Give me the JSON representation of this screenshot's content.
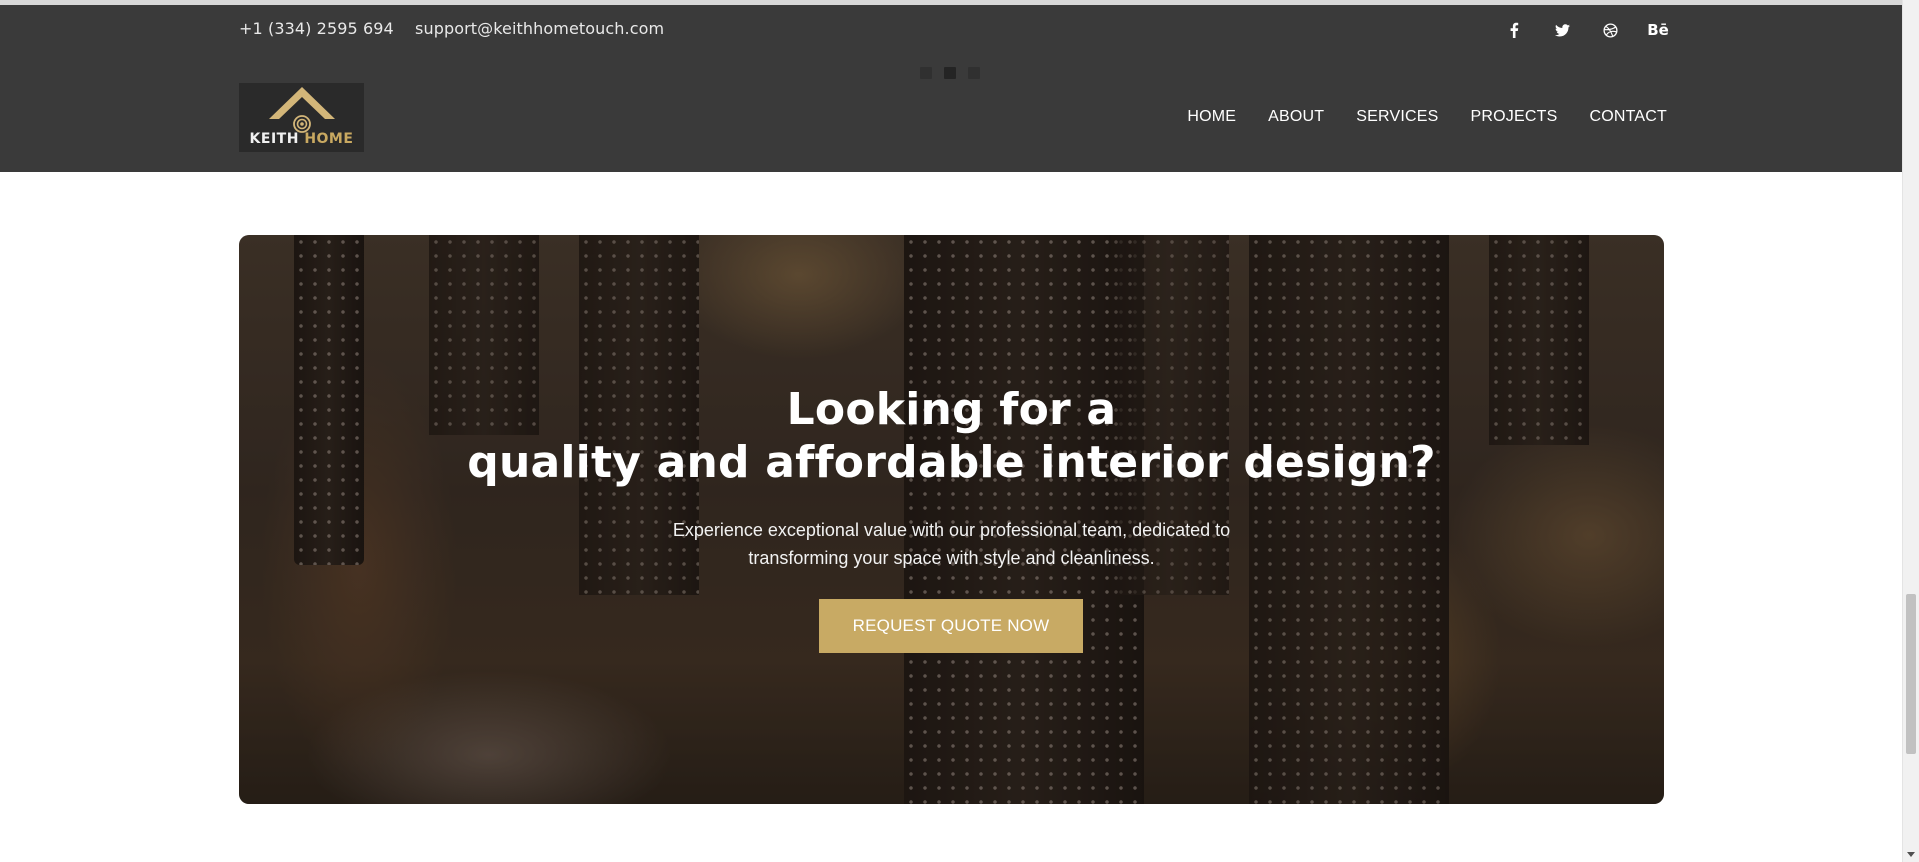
{
  "topbar": {
    "phone": "+1 (334) 2595 694",
    "email": "support@keithhometouch.com",
    "social": [
      {
        "icon": "facebook-icon",
        "glyph": "f"
      },
      {
        "icon": "twitter-icon",
        "glyph": "🐦"
      },
      {
        "icon": "dribbble-icon",
        "glyph": "◎"
      },
      {
        "icon": "behance-icon",
        "glyph": "Bē"
      }
    ]
  },
  "logo": {
    "word1": "KEITH",
    "word2": "HOME",
    "accent_color": "#c9a961"
  },
  "nav": {
    "items": [
      "HOME",
      "ABOUT",
      "SERVICES",
      "PROJECTS",
      "CONTACT"
    ]
  },
  "hero": {
    "title_line1": "Looking for a",
    "title_line2": "quality and affordable interior design?",
    "subtitle_line1": "Experience exceptional value with our professional team, dedicated to",
    "subtitle_line2": "transforming your space with style and cleanliness.",
    "cta_label": "REQUEST QUOTE NOW",
    "cta_color": "#c8aa64"
  }
}
